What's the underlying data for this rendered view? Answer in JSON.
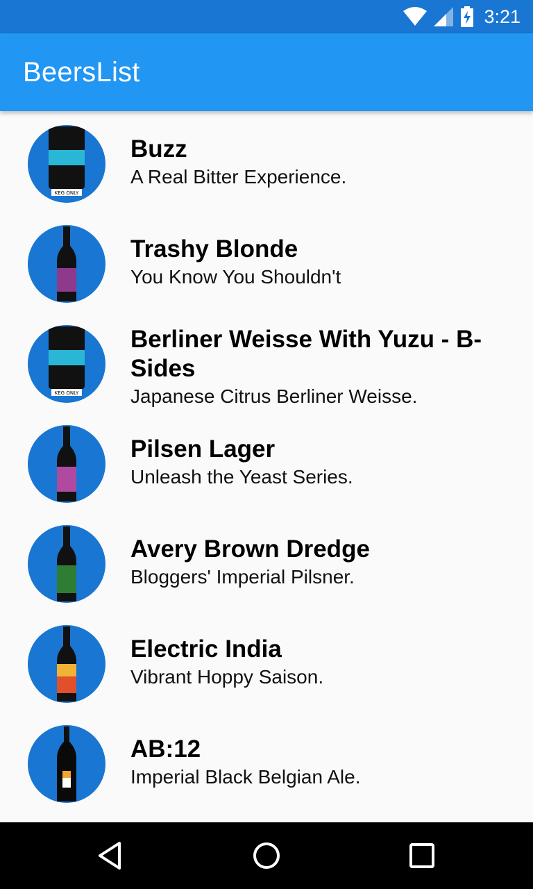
{
  "status_bar": {
    "time": "3:21",
    "icons": [
      "wifi-icon",
      "signal-icon",
      "battery-charging-icon"
    ],
    "color": "#1976d2"
  },
  "app_bar": {
    "title": "BeersList",
    "color": "#2196f3"
  },
  "beers": [
    {
      "name": "Buzz",
      "tagline": "A Real Bitter Experience.",
      "image": "keg"
    },
    {
      "name": "Trashy Blonde",
      "tagline": "You Know You Shouldn't",
      "image": "bottle-purple"
    },
    {
      "name": "Berliner Weisse With Yuzu - B-Sides",
      "tagline": "Japanese Citrus Berliner Weisse.",
      "image": "keg"
    },
    {
      "name": "Pilsen Lager",
      "tagline": "Unleash the Yeast Series.",
      "image": "bottle-magenta"
    },
    {
      "name": "Avery Brown Dredge",
      "tagline": "Bloggers' Imperial Pilsner.",
      "image": "bottle-green"
    },
    {
      "name": "Electric India",
      "tagline": "Vibrant Hoppy Saison.",
      "image": "bottle-orange"
    },
    {
      "name": "AB:12",
      "tagline": "Imperial Black Belgian Ale.",
      "image": "bottle-black"
    }
  ],
  "nav_bar": {
    "buttons": [
      "back-icon",
      "home-icon",
      "recents-icon"
    ]
  },
  "colors": {
    "avatar_bg": "#1976d2",
    "background": "#fafafa"
  }
}
